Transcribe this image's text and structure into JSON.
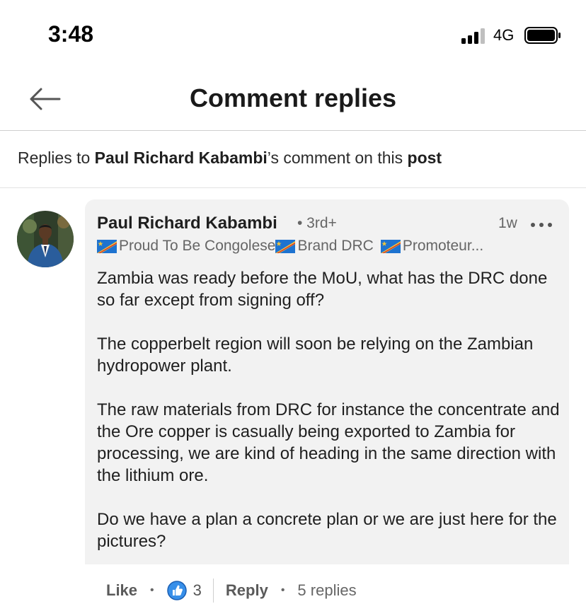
{
  "status_bar": {
    "time": "3:48",
    "network": "4G"
  },
  "header": {
    "title": "Comment replies"
  },
  "context": {
    "prefix": "Replies to ",
    "author": "Paul Richard Kabambi",
    "middle": "’s comment on this ",
    "post": "post"
  },
  "comment": {
    "author": "Paul Richard Kabambi",
    "degree": "• 3rd+",
    "time": "1w",
    "headline_parts": [
      "Proud To Be Congolese",
      "Brand DRC",
      "Promoteur..."
    ],
    "paragraphs": [
      "Zambia was ready before the MoU, what has the DRC done so far except from signing off?",
      "The copperbelt region will soon be relying on the Zambian hydropower plant.",
      "The raw materials from DRC for instance the concentrate and the Ore copper is casually being exported to Zambia for processing, we are kind of heading in the same direction with the lithium ore.",
      "Do we have a plan a concrete plan or we are just here for the pictures?"
    ]
  },
  "actions": {
    "like_label": "Like",
    "like_count": "3",
    "reply_label": "Reply",
    "replies_count": "5 replies"
  },
  "colors": {
    "like_blue": "#378fe9",
    "bubble_bg": "#f2f2f2"
  }
}
